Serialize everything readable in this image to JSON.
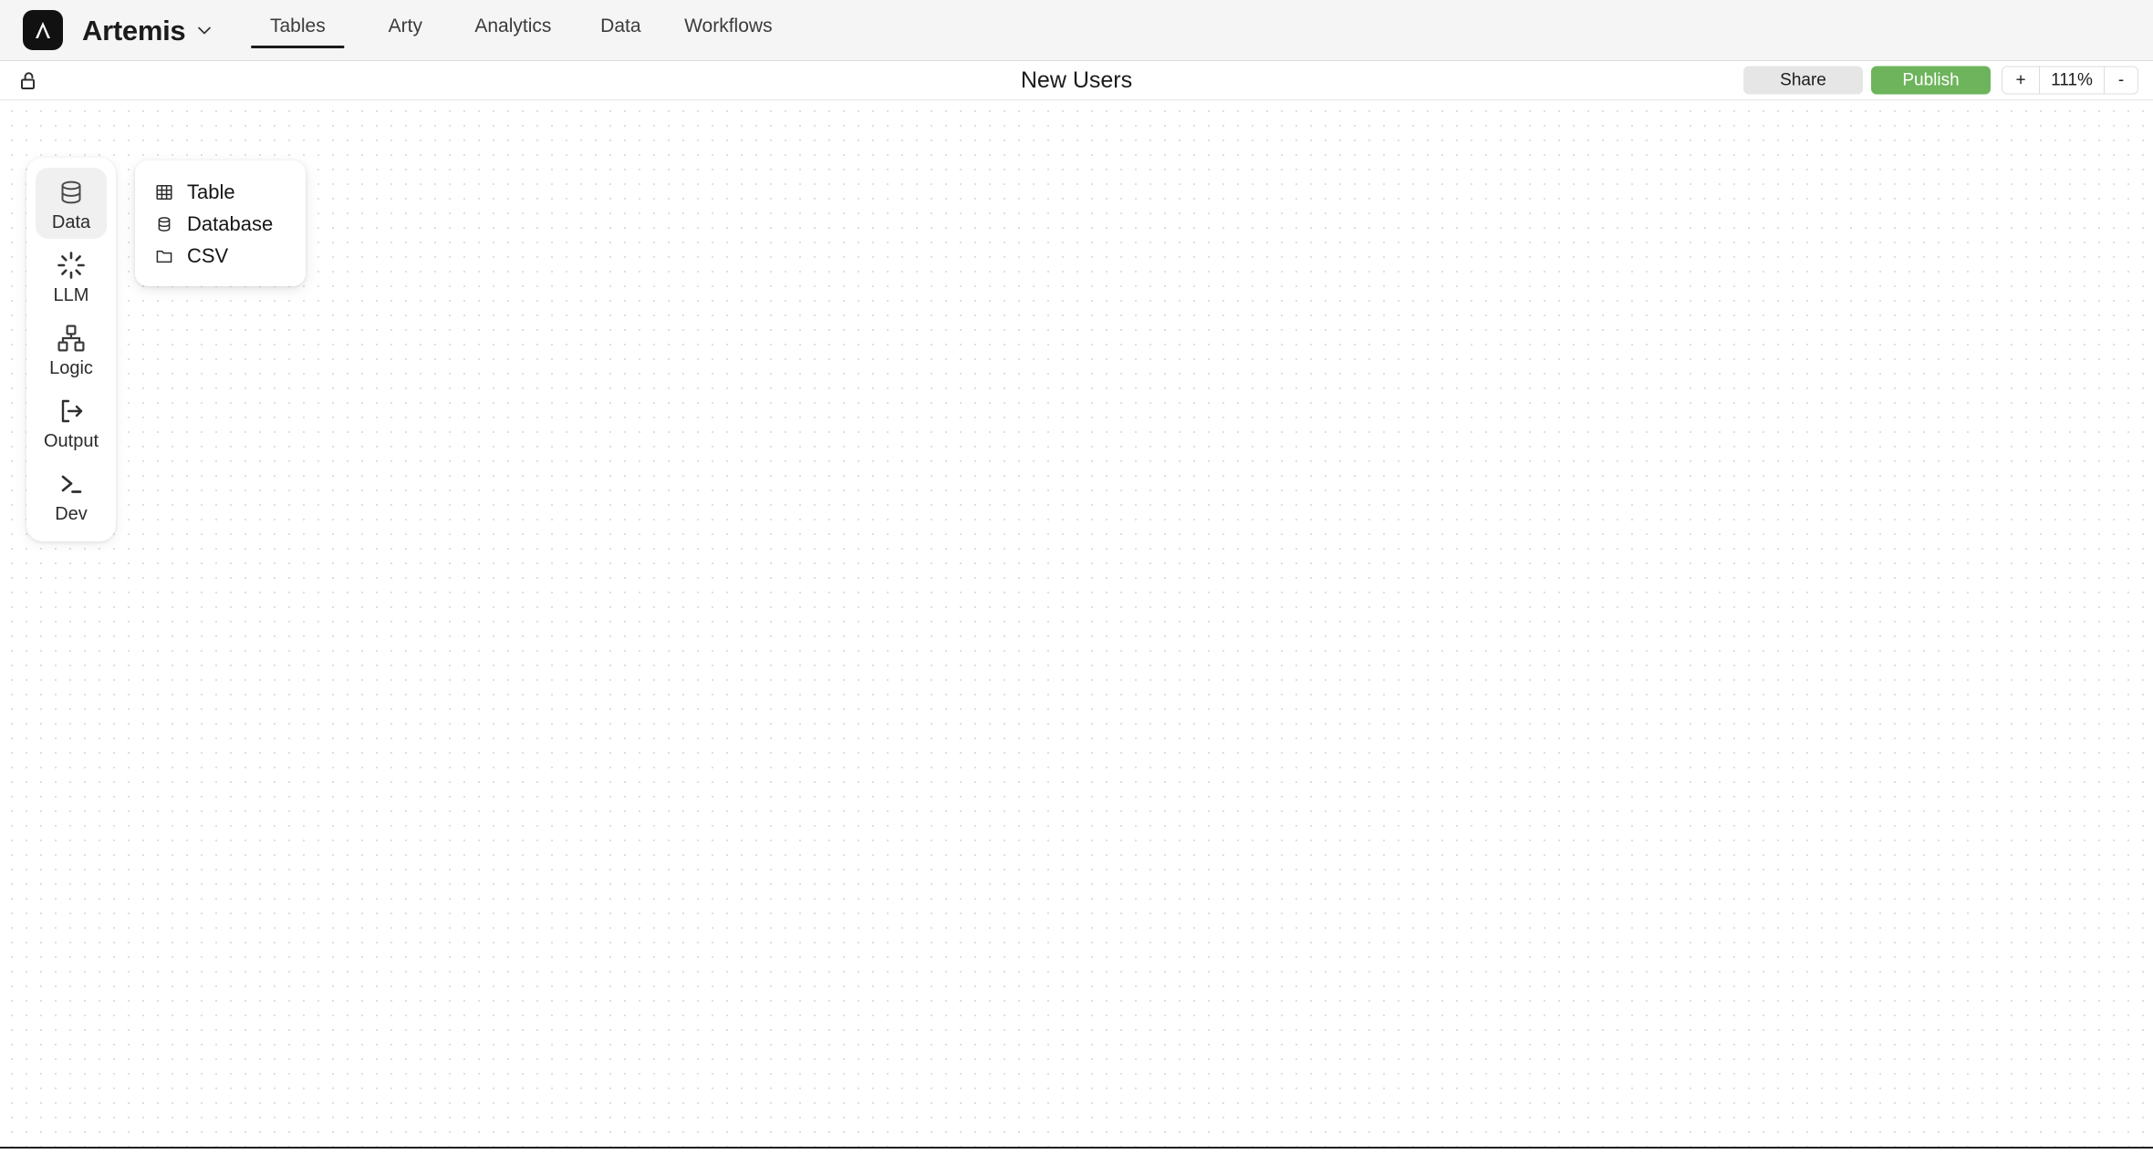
{
  "app": {
    "brand": "Artemis",
    "logo_icon": "lambda-logo-icon",
    "brand_caret_icon": "chevron-down-icon"
  },
  "nav": {
    "tabs": [
      {
        "label": "Tables",
        "active": true
      },
      {
        "label": "Arty",
        "active": false
      },
      {
        "label": "Analytics",
        "active": false
      },
      {
        "label": "Data",
        "active": false
      },
      {
        "label": "Workflows",
        "active": false
      }
    ]
  },
  "toolbar": {
    "lock_icon": "unlock-icon",
    "doc_title": "New Users",
    "share_label": "Share",
    "publish_label": "Publish",
    "zoom_in_label": "+",
    "zoom_level": "111%",
    "zoom_out_label": "-"
  },
  "palette": {
    "items": [
      {
        "label": "Data",
        "icon": "database-icon",
        "active": true
      },
      {
        "label": "LLM",
        "icon": "sparkle-icon",
        "active": false
      },
      {
        "label": "Logic",
        "icon": "hierarchy-icon",
        "active": false
      },
      {
        "label": "Output",
        "icon": "export-icon",
        "active": false
      },
      {
        "label": "Dev",
        "icon": "terminal-icon",
        "active": false
      }
    ]
  },
  "dropdown": {
    "items": [
      {
        "label": "Table",
        "icon": "grid-table-icon"
      },
      {
        "label": "Database",
        "icon": "database-icon"
      },
      {
        "label": "CSV",
        "icon": "folder-icon"
      }
    ]
  },
  "colors": {
    "publish_green": "#6db45c",
    "share_gray": "#e6e6e6",
    "topbar_bg": "#f5f5f5",
    "canvas_dot": "#dfdfdf",
    "accent_dark": "#1b1b1b"
  }
}
